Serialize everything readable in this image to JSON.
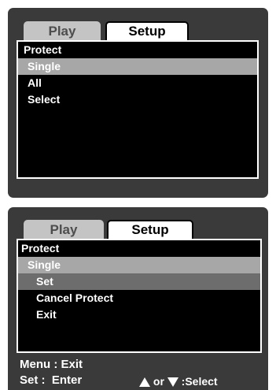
{
  "screen1": {
    "tabs": [
      "Play",
      "Setup"
    ],
    "title": "Protect",
    "items": [
      "Single",
      "All",
      "Select"
    ],
    "selected_item": "Single"
  },
  "screen2": {
    "tabs": [
      "Play",
      "Setup"
    ],
    "title": "Protect",
    "parent_item": "Single",
    "subitems": [
      "Set",
      "Cancel Protect",
      "Exit"
    ],
    "selected_subitem": "Set",
    "footer": {
      "menu_key": "Menu",
      "menu_action": "Exit",
      "set_key": "Set",
      "set_action": "Enter",
      "or_text": "or",
      "select_text": ":Select"
    }
  },
  "colors": {
    "screen_bg": "#3a3a3a",
    "highlight": "#a7a7a7",
    "highlight_dark": "#6d6d6d",
    "inactive_tab": "#c4c4c4"
  },
  "icons": [
    "up-arrow-icon",
    "down-arrow-icon"
  ]
}
